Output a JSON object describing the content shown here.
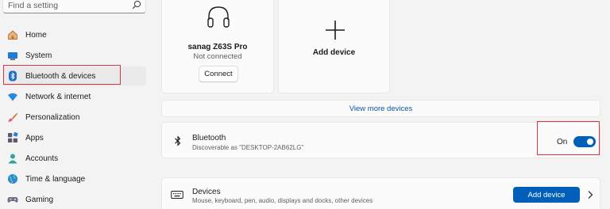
{
  "search": {
    "placeholder": "Find a setting"
  },
  "sidebar": {
    "items": [
      {
        "label": "Home",
        "icon": "home-icon"
      },
      {
        "label": "System",
        "icon": "system-icon"
      },
      {
        "label": "Bluetooth & devices",
        "icon": "bluetooth-icon",
        "selected": true
      },
      {
        "label": "Network & internet",
        "icon": "network-icon"
      },
      {
        "label": "Personalization",
        "icon": "brush-icon"
      },
      {
        "label": "Apps",
        "icon": "apps-icon"
      },
      {
        "label": "Accounts",
        "icon": "accounts-icon"
      },
      {
        "label": "Time & language",
        "icon": "globe-icon"
      },
      {
        "label": "Gaming",
        "icon": "gamepad-icon"
      }
    ]
  },
  "device_card": {
    "name": "sanag Z63S Pro",
    "status": "Not connected",
    "connect_label": "Connect"
  },
  "add_card": {
    "label": "Add device"
  },
  "view_more": {
    "label": "View more devices"
  },
  "bluetooth": {
    "title": "Bluetooth",
    "subtitle": "Discoverable as \"DESKTOP-2AB62LG\"",
    "state_label": "On",
    "enabled": true
  },
  "devices": {
    "title": "Devices",
    "subtitle": "Mouse, keyboard, pen, audio, displays and docks, other devices",
    "button_label": "Add device"
  },
  "colors": {
    "accent": "#005fb8",
    "link": "#0c54a6",
    "highlight": "#e0343c"
  }
}
